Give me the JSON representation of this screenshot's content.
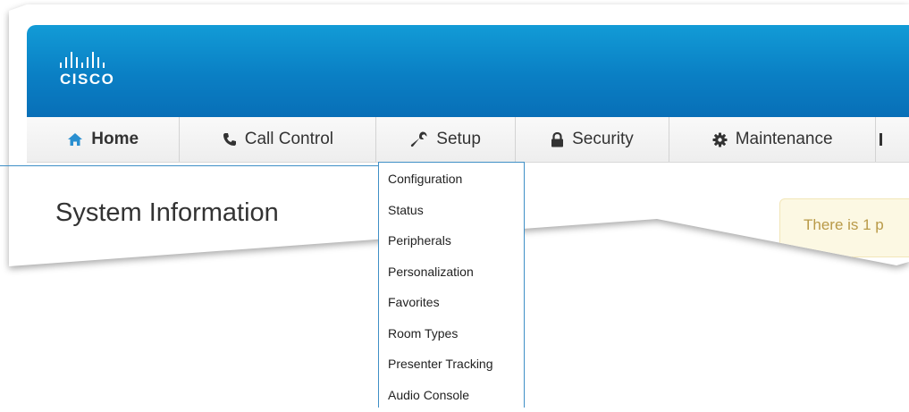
{
  "brand": {
    "logo_text": "CISCO"
  },
  "nav": {
    "items": [
      {
        "label": "Home",
        "icon": "home-icon",
        "active": true
      },
      {
        "label": "Call Control",
        "icon": "phone-icon"
      },
      {
        "label": "Setup",
        "icon": "wrench-icon"
      },
      {
        "label": "Security",
        "icon": "lock-icon"
      },
      {
        "label": "Maintenance",
        "icon": "gear-icon"
      }
    ]
  },
  "main": {
    "title": "System Information",
    "alert_text": "There is 1 p"
  },
  "dropdown": {
    "items": [
      "Configuration",
      "Status",
      "Peripherals",
      "Personalization",
      "Favorites",
      "Room Types",
      "Presenter Tracking",
      "Audio Console"
    ]
  },
  "colors": {
    "banner": "#0a7fc4",
    "accent": "#3f8fc6",
    "alert_bg": "#fcf8e3",
    "alert_text": "#b99a48"
  }
}
